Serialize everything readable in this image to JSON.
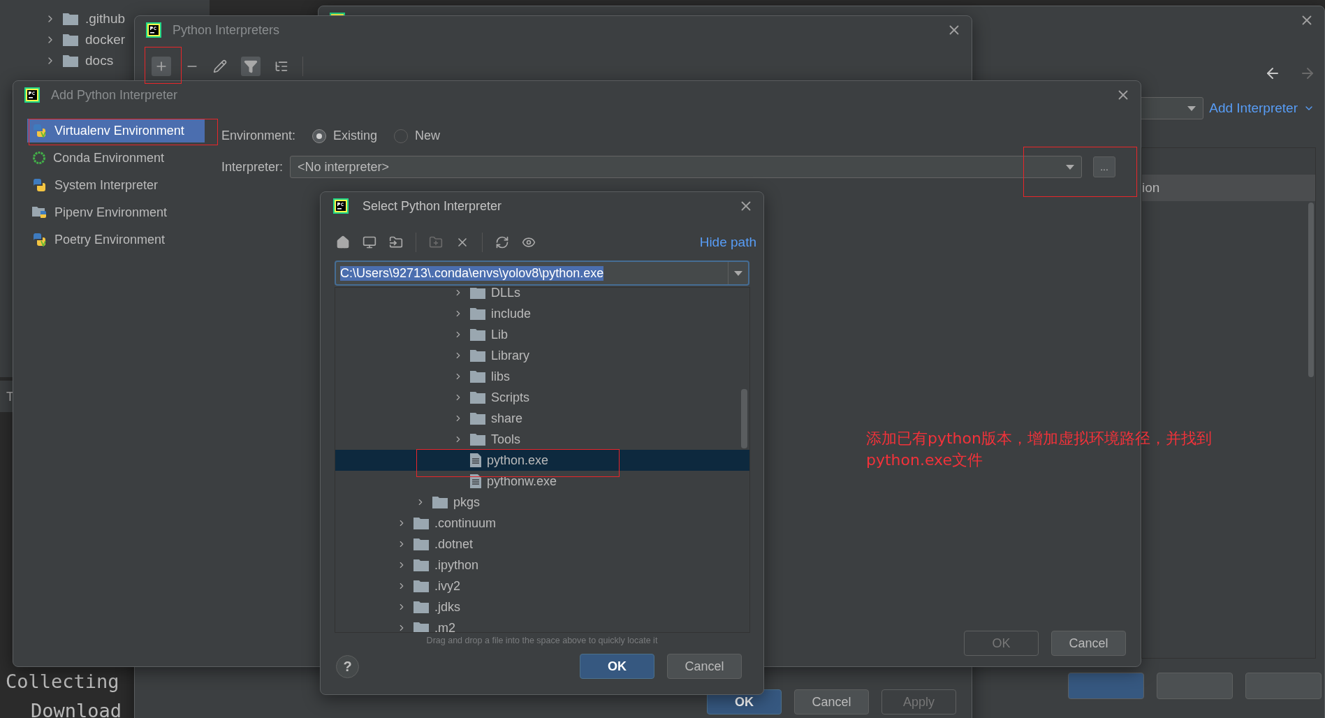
{
  "ide": {
    "project_tree": [
      {
        "label": ".github"
      },
      {
        "label": "docker"
      },
      {
        "label": "docs"
      }
    ],
    "tool_tab": "T",
    "terminal_lines": [
      {
        "text": "Collecting",
        "kind": "plain"
      },
      {
        "text": "Download",
        "kind": "indent"
      }
    ]
  },
  "settings": {
    "add_interpreter_link": "Add Interpreter",
    "table_cell": "ion"
  },
  "python_interpreters": {
    "title": "Python Interpreters",
    "buttons": [
      {
        "label": "OK",
        "kind": "primary",
        "disabled": false
      },
      {
        "label": "Cancel",
        "kind": "normal",
        "disabled": false
      },
      {
        "label": "Apply",
        "kind": "normal",
        "disabled": true
      }
    ]
  },
  "add_interpreter": {
    "title": "Add Python Interpreter",
    "environment_types": [
      {
        "label": "Virtualenv Environment",
        "kind": "virtualenv",
        "selected": true
      },
      {
        "label": "Conda Environment",
        "kind": "conda",
        "selected": false
      },
      {
        "label": "System Interpreter",
        "kind": "system",
        "selected": false
      },
      {
        "label": "Pipenv Environment",
        "kind": "pipenv",
        "selected": false
      },
      {
        "label": "Poetry Environment",
        "kind": "poetry",
        "selected": false
      }
    ],
    "environment_label": "Environment:",
    "environment_options": [
      {
        "label": "Existing",
        "selected": true
      },
      {
        "label": "New",
        "selected": false
      }
    ],
    "interpreter_label": "Interpreter:",
    "interpreter_value": "<No interpreter>",
    "browse_button": "...",
    "buttons": [
      {
        "label": "OK",
        "kind": "primary",
        "disabled": true
      },
      {
        "label": "Cancel",
        "kind": "normal",
        "disabled": false
      }
    ]
  },
  "select_dialog": {
    "title": "Select Python Interpreter",
    "hide_path_link": "Hide path",
    "path": {
      "value": "C:\\Users\\92713\\.conda\\envs\\yolov8\\python.exe",
      "selected": true
    },
    "tree": [
      {
        "children": [
          {
            "children": [
              {
                "children": [
                  {
                    "label": "DLLs",
                    "kind": "folder",
                    "selected": false
                  },
                  {
                    "label": "include",
                    "kind": "folder",
                    "selected": false
                  },
                  {
                    "label": "Lib",
                    "kind": "folder",
                    "selected": false
                  },
                  {
                    "label": "Library",
                    "kind": "folder",
                    "selected": false
                  },
                  {
                    "label": "libs",
                    "kind": "folder",
                    "selected": false
                  },
                  {
                    "label": "Scripts",
                    "kind": "folder",
                    "selected": false
                  },
                  {
                    "label": "share",
                    "kind": "folder",
                    "selected": false
                  },
                  {
                    "label": "Tools",
                    "kind": "folder",
                    "selected": false
                  },
                  {
                    "label": "python.exe",
                    "kind": "file",
                    "selected": true
                  },
                  {
                    "label": "pythonw.exe",
                    "kind": "file",
                    "selected": false
                  }
                ]
              }
            ]
          },
          {
            "label": "pkgs",
            "kind": "folder",
            "selected": false
          }
        ]
      },
      {
        "label": ".continuum",
        "kind": "folder",
        "selected": false
      },
      {
        "label": ".dotnet",
        "kind": "folder",
        "selected": false
      },
      {
        "label": ".ipython",
        "kind": "folder",
        "selected": false
      },
      {
        "label": ".ivy2",
        "kind": "folder",
        "selected": false
      },
      {
        "label": ".jdks",
        "kind": "folder",
        "selected": false
      },
      {
        "label": ".m2",
        "kind": "folder",
        "selected": false
      }
    ],
    "hint": "Drag and drop a file into the space above to quickly locate it",
    "help_button": "?",
    "buttons": [
      {
        "label": "OK",
        "kind": "primary",
        "disabled": false
      },
      {
        "label": "Cancel",
        "kind": "normal",
        "disabled": false
      }
    ]
  },
  "note_lines": [
    "添加已有python版本，增加虚拟环境路径，并找到",
    "python.exe文件"
  ]
}
